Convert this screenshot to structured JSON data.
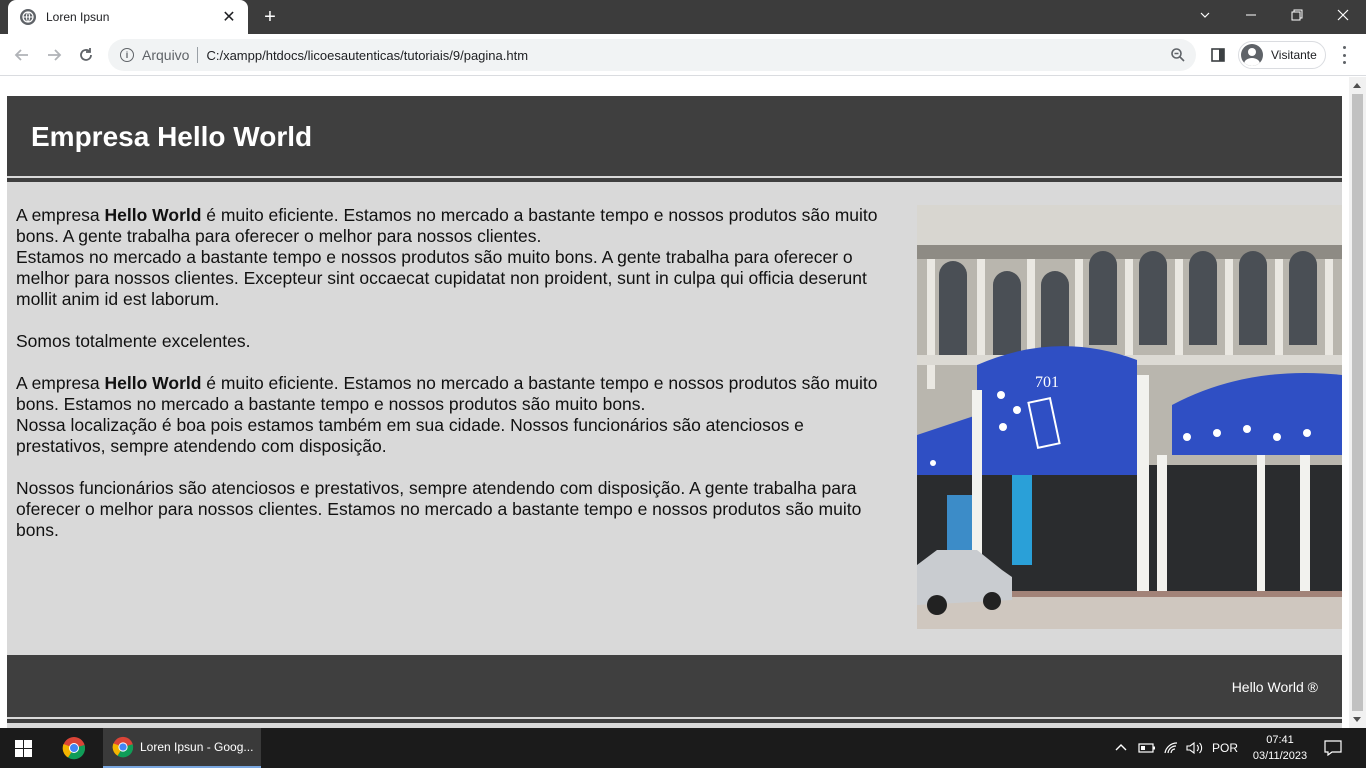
{
  "browser": {
    "tab_title": "Loren Ipsun",
    "new_tab": "+",
    "scheme_label": "Arquivo",
    "url": "C:/xampp/htdocs/licoesautenticas/tutoriais/9/pagina.htm",
    "profile_name": "Visitante"
  },
  "page": {
    "header_title": "Empresa Hello World",
    "paragraphs": {
      "p1_pre": "A empresa ",
      "p1_bold": "Hello World",
      "p1_post": " é muito eficiente. Estamos no mercado a bastante tempo e nossos produtos são muito bons. A gente trabalha para oferecer o melhor para nossos clientes.",
      "p1_line2": "Estamos no mercado a bastante tempo e nossos produtos são muito bons. A gente trabalha para oferecer o melhor para nossos clientes. Excepteur sint occaecat cupidatat non proident, sunt in culpa qui officia deserunt mollit anim id est laborum.",
      "p2": "Somos totalmente excelentes.",
      "p3_pre": "A empresa ",
      "p3_bold": "Hello World",
      "p3_post": " é muito eficiente. Estamos no mercado a bastante tempo e nossos produtos são muito bons. Estamos no mercado a bastante tempo e nossos produtos são muito bons.",
      "p3_line2": "Nossa localização é boa pois estamos também em sua cidade. Nossos funcionários são atenciosos e prestativos, sempre atendendo com disposição.",
      "p4": "Nossos funcionários são atenciosos e prestativos, sempre atendendo com disposição. A gente trabalha para oferecer o melhor para nossos clientes. Estamos no mercado a bastante tempo e nossos produtos são muito bons."
    },
    "photo": {
      "awning_number": "701"
    },
    "footer_text": "Hello World ®"
  },
  "taskbar": {
    "app_title": "Loren Ipsun - Goog...",
    "language": "POR",
    "time": "07:41",
    "date": "03/11/2023"
  },
  "colors": {
    "header_bg": "#3f3f3f",
    "page_bg": "#d9d9d9",
    "awning_blue": "#2f4fc4"
  }
}
